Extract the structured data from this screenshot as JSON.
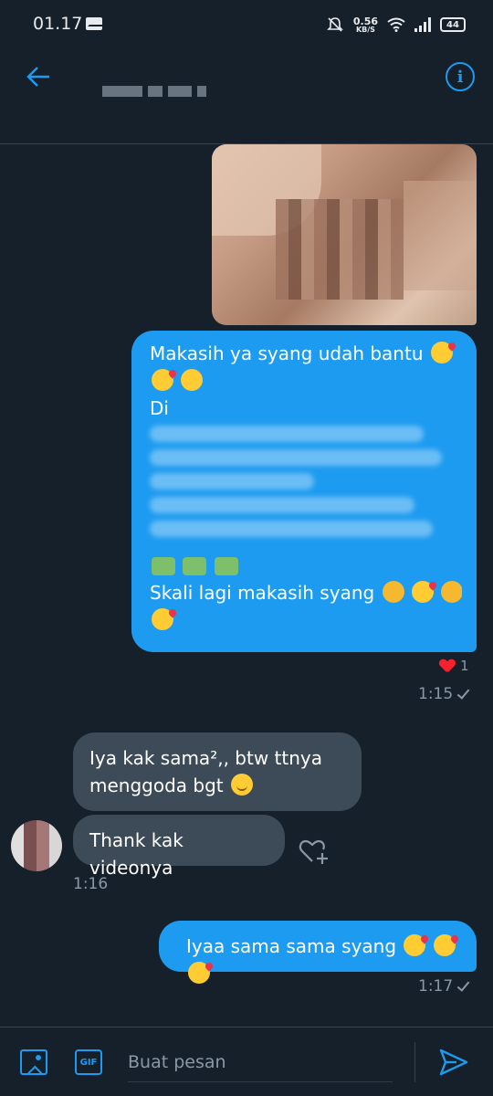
{
  "status_bar": {
    "time": "01.17",
    "net_speed_value": "0.56",
    "net_speed_unit": "KB/S",
    "battery": "44"
  },
  "colors": {
    "background": "#15202b",
    "accent": "#1d9bf0",
    "received_bubble": "#3d4a58",
    "secondary_text": "#8b98a5",
    "like": "#f4212e"
  },
  "messages": {
    "sent_1": {
      "line1": "Makasih ya syang udah bantu",
      "line2_prefix": "Di",
      "closing": "Skali lagi makasih syang"
    },
    "sent_1_reaction_count": "1",
    "sent_1_time": "1:15",
    "recv_1": "Iya kak sama²,, btw ttnya menggoda bgt",
    "recv_2": "Thank kak videonya",
    "recv_time": "1:16",
    "sent_2": "Iyaa sama sama syang",
    "sent_2_time": "1:17"
  },
  "composer": {
    "placeholder": "Buat pesan",
    "gif_label": "GIF"
  },
  "icons": [
    "back-arrow-icon",
    "info-icon",
    "heart-icon",
    "check-icon",
    "add-reaction-icon",
    "image-icon",
    "gif-icon",
    "send-icon"
  ]
}
